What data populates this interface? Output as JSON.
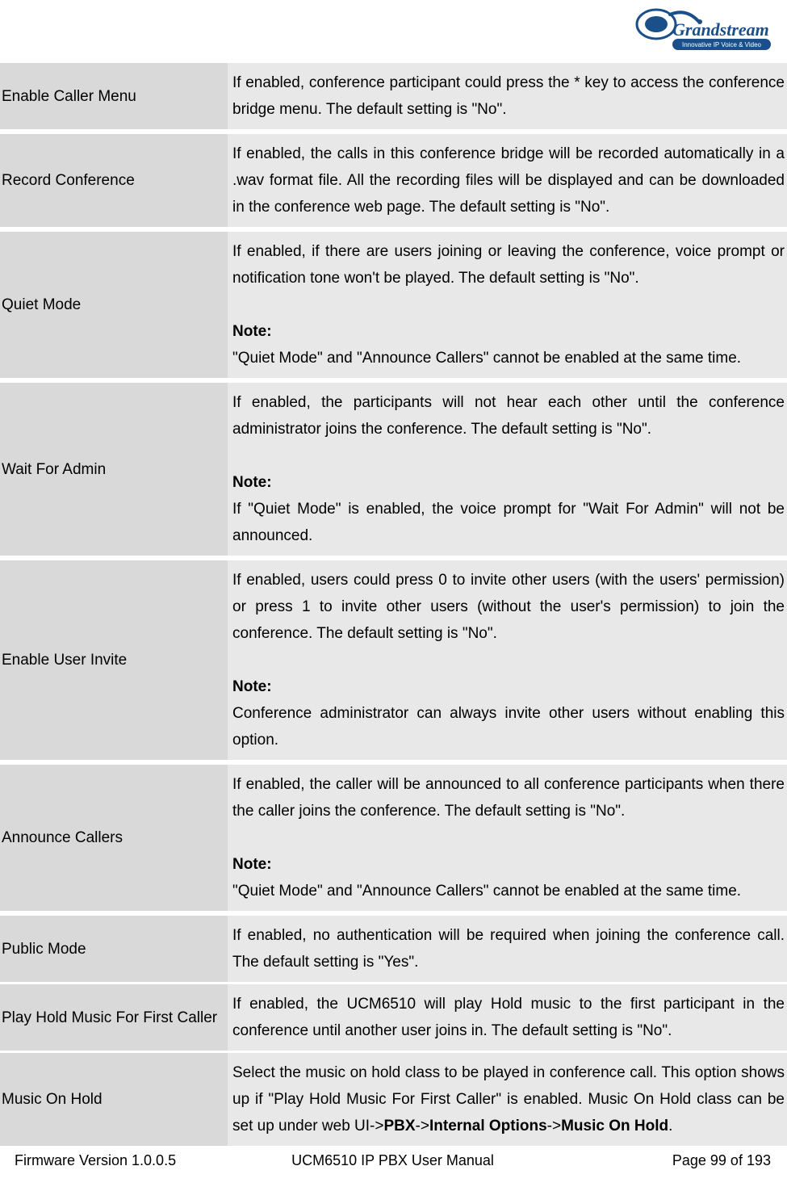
{
  "brand": {
    "name": "Grandstream",
    "tagline": "Innovative IP Voice & Video"
  },
  "rows": [
    {
      "label": "Enable Caller Menu",
      "desc_parts": [
        {
          "t": "If enabled, conference participant could press the * key to access the conference bridge menu. The default setting is \"No\"."
        }
      ]
    },
    {
      "label": "Record Conference",
      "desc_parts": [
        {
          "t": "If enabled, the calls in this conference bridge will be recorded automatically in a .wav format file. All the recording files will be displayed and can be downloaded in the conference web page. The default setting is \"No\"."
        }
      ]
    },
    {
      "label": "Quiet Mode",
      "desc_parts": [
        {
          "t": "If enabled, if there are users joining or leaving the conference, voice prompt or notification tone won't be played. The default setting is \"No\"."
        },
        {
          "spacer": true
        },
        {
          "t": "Note:",
          "bold": true
        },
        {
          "t": "\"Quiet Mode\" and \"Announce Callers\" cannot be enabled at the same time."
        }
      ]
    },
    {
      "label": "Wait For Admin",
      "desc_parts": [
        {
          "t": "If enabled, the participants will not hear each other until the conference administrator joins the conference. The default setting is \"No\"."
        },
        {
          "spacer": true
        },
        {
          "t": "Note:",
          "bold": true
        },
        {
          "t": "If \"Quiet Mode\" is enabled, the voice prompt for \"Wait For Admin\" will not be announced."
        }
      ]
    },
    {
      "label": "Enable User Invite",
      "desc_parts": [
        {
          "t": "If enabled, users could press 0 to invite other users (with the users' permission) or press 1 to invite other users (without the user's permission)  to join the conference. The default setting is \"No\"."
        },
        {
          "spacer": true
        },
        {
          "t": "Note:",
          "bold": true
        },
        {
          "t": "Conference administrator can always invite other users without enabling this option."
        }
      ]
    },
    {
      "label": "Announce Callers",
      "desc_parts": [
        {
          "t": "If enabled, the caller will be announced to all conference participants when there the caller joins the conference. The default setting is \"No\"."
        },
        {
          "spacer": true
        },
        {
          "t": "Note:",
          "bold": true
        },
        {
          "t": "\"Quiet Mode\" and \"Announce Callers\" cannot be enabled at the same time."
        }
      ]
    },
    {
      "label": "Public Mode",
      "desc_parts": [
        {
          "t": "If enabled, no authentication will be required when joining the conference call. The default setting is \"Yes\"."
        }
      ]
    },
    {
      "label": "Play Hold Music For First Caller",
      "desc_parts": [
        {
          "t": "If enabled, the UCM6510 will play Hold music to the first participant in the conference until another user joins in. The default setting is \"No\"."
        }
      ]
    },
    {
      "label": "Music On Hold",
      "desc_parts": [
        {
          "mixed": [
            {
              "t": "Select the music on hold class to be played in conference call. This option shows up if \"Play Hold Music For First Caller\" is enabled. Music On Hold class can be set up under web UI->"
            },
            {
              "t": "PBX",
              "bold": true
            },
            {
              "t": "->"
            },
            {
              "t": "Internal Options",
              "bold": true
            },
            {
              "t": "->"
            },
            {
              "t": "Music On Hold",
              "bold": true
            },
            {
              "t": "."
            }
          ]
        }
      ]
    }
  ],
  "footer": {
    "left": "Firmware Version 1.0.0.5",
    "center": "UCM6510 IP PBX User Manual",
    "right": "Page 99 of 193"
  }
}
